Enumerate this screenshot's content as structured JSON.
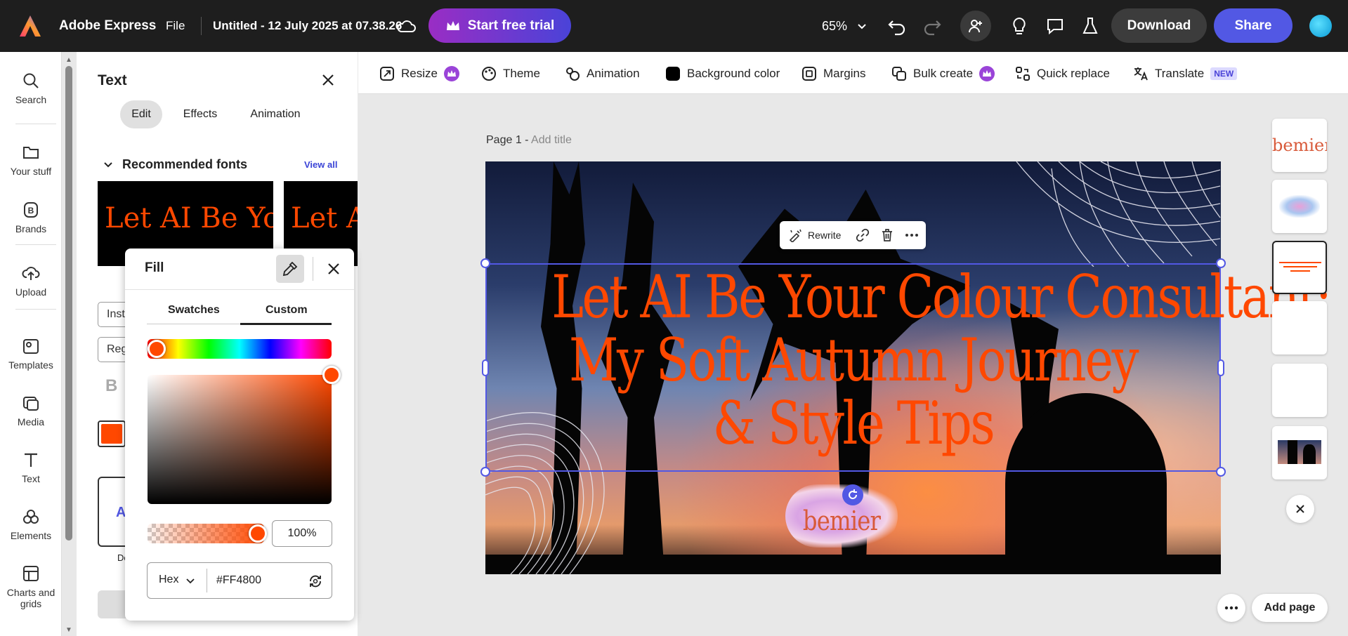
{
  "app": {
    "name": "Adobe Express",
    "file_menu": "File",
    "doc_title": "Untitled - 12 July 2025 at 07.38.26",
    "trial_label": "Start free trial",
    "zoom": "65%",
    "download_label": "Download",
    "share_label": "Share"
  },
  "rail": {
    "items": [
      {
        "label": "Search",
        "icon": "search-icon"
      },
      {
        "label": "Your stuff",
        "icon": "folder-icon"
      },
      {
        "label": "Brands",
        "icon": "brand-icon"
      },
      {
        "label": "Upload",
        "icon": "upload-icon"
      },
      {
        "label": "Templates",
        "icon": "templates-icon"
      },
      {
        "label": "Media",
        "icon": "media-icon"
      },
      {
        "label": "Text",
        "icon": "text-icon"
      },
      {
        "label": "Elements",
        "icon": "elements-icon"
      },
      {
        "label": "Charts and grids",
        "icon": "charts-icon"
      }
    ]
  },
  "panel": {
    "title": "Text",
    "tabs": [
      "Edit",
      "Effects",
      "Animation"
    ],
    "active_tab": "Edit",
    "recommended_title": "Recommended fonts",
    "view_all": "View all",
    "font_preview_1": "Let AI Be Your",
    "font_preview_2": "Let AI",
    "ghost_input_1": "Inst",
    "ghost_input_2": "Reg",
    "ghost_bold": "B",
    "ghost_card": "A",
    "ghost_label": "De"
  },
  "fill": {
    "title": "Fill",
    "tabs": [
      "Swatches",
      "Custom"
    ],
    "active_tab": "Custom",
    "color": "#FF4800",
    "opacity": "100%",
    "mode": "Hex",
    "hex_value": "#FF4800"
  },
  "toolbar": {
    "items": [
      {
        "label": "Resize",
        "icon": "resize-icon",
        "premium": true
      },
      {
        "label": "Theme",
        "icon": "theme-icon"
      },
      {
        "label": "Animation",
        "icon": "animation-icon"
      },
      {
        "label": "Background color",
        "icon": "background-color-icon"
      },
      {
        "label": "Margins",
        "icon": "margins-icon"
      },
      {
        "label": "Bulk create",
        "icon": "bulk-create-icon",
        "premium": true
      },
      {
        "label": "Quick replace",
        "icon": "quick-replace-icon"
      },
      {
        "label": "Translate",
        "icon": "translate-icon",
        "badge": "NEW"
      }
    ]
  },
  "canvas": {
    "page_label": "Page 1 - ",
    "add_title": "Add title",
    "headline_lines": [
      "Let AI Be Your Colour Consultant:",
      "My Soft Autumn Journey",
      "& Style Tips"
    ],
    "float_bar": {
      "rewrite": "Rewrite"
    },
    "logo_text": "bemier"
  },
  "thumbs": {
    "first_text": "bemier"
  },
  "footer": {
    "add_page": "Add page"
  }
}
